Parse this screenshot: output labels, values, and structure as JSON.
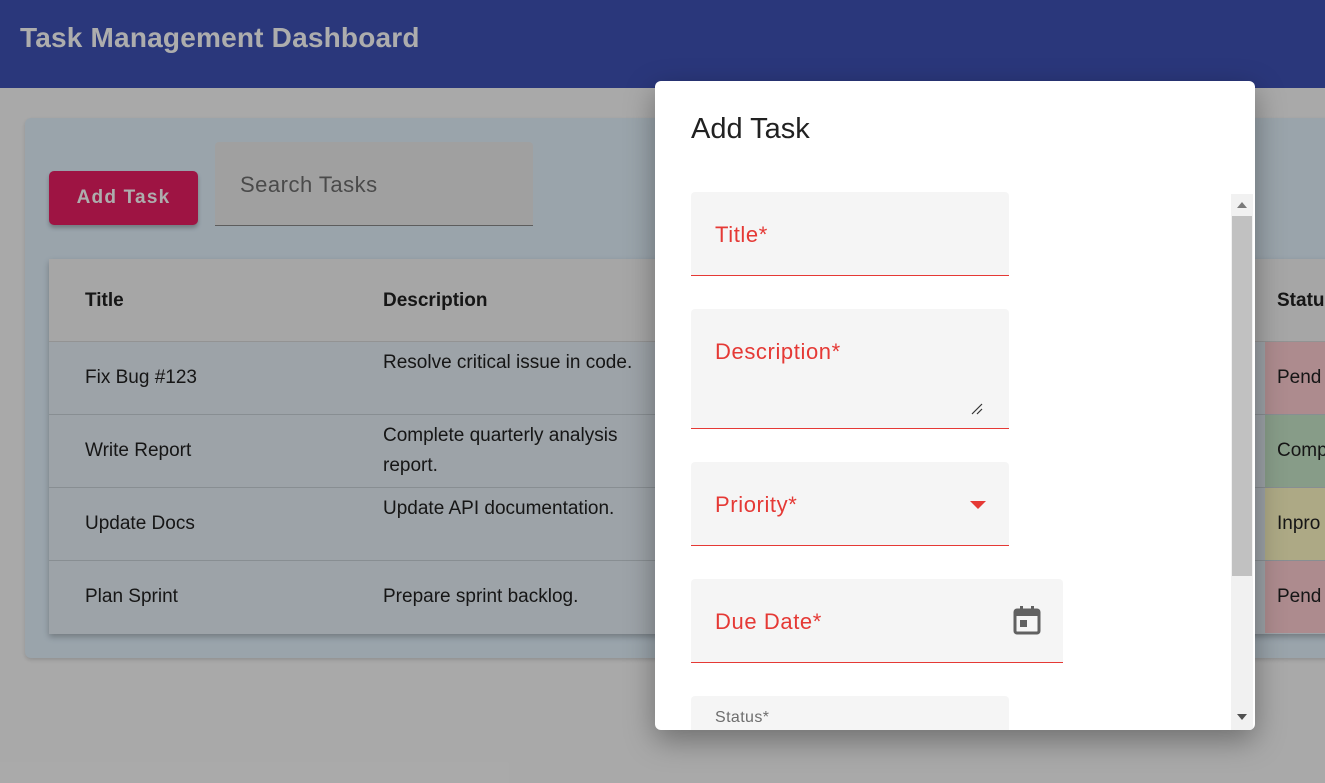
{
  "app": {
    "title": "Task Management Dashboard"
  },
  "toolbar": {
    "add_task_label": "Add Task",
    "search_placeholder": "Search Tasks"
  },
  "table": {
    "columns": [
      "Title",
      "Description",
      "Statu"
    ],
    "rows": [
      {
        "title": "Fix Bug #123",
        "description": "Resolve critical issue in code.",
        "status": "Pend",
        "status_color": "#ffcdd2"
      },
      {
        "title": "Write Report",
        "description": "Complete quarterly analysis report.",
        "status": "Comp",
        "status_color": "#c8e6c9"
      },
      {
        "title": "Update Docs",
        "description": "Update API documentation.",
        "status": "Inpro",
        "status_color": "#fff9c4"
      },
      {
        "title": "Plan Sprint",
        "description": "Prepare sprint backlog.",
        "status": "Pend",
        "status_color": "#ffcdd2"
      }
    ]
  },
  "dialog": {
    "title": "Add Task",
    "fields": {
      "title_label": "Title*",
      "description_label": "Description*",
      "priority_label": "Priority*",
      "due_date_label": "Due Date*",
      "status_label": "Status*"
    }
  },
  "colors": {
    "appbar": "#3f51b5",
    "accent": "#e91e63",
    "error": "#e53935",
    "panel": "#e3f2fd"
  },
  "icons": [
    "calendar-icon",
    "dropdown-arrow-icon",
    "resize-handle-icon"
  ]
}
